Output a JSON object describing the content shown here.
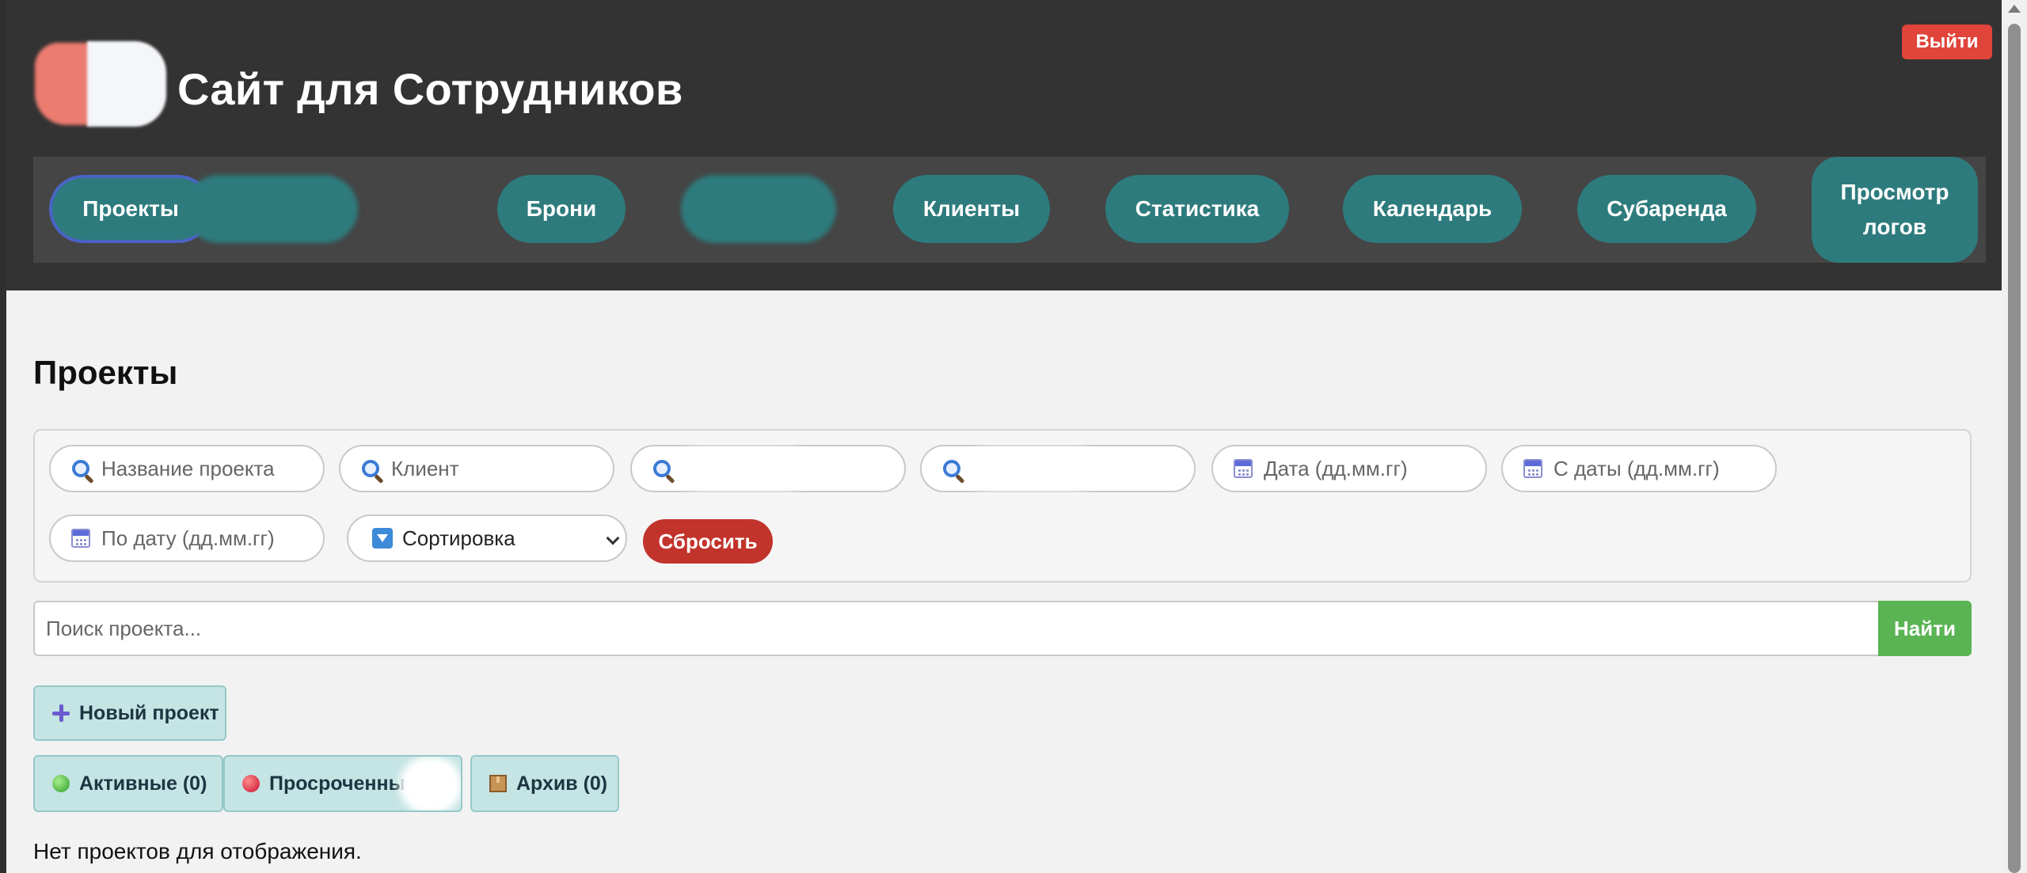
{
  "header": {
    "site_title": "Сайт для Сотрудников",
    "logout_label": "Выйти",
    "logo_colors": [
      "#ec7b70",
      "#f4f6f9"
    ]
  },
  "nav": {
    "items": [
      {
        "label": "Проекты",
        "active": true
      },
      {
        "label": "",
        "redacted": true
      },
      {
        "label": "Брони"
      },
      {
        "label": "",
        "redacted": true
      },
      {
        "label": "Клиенты"
      },
      {
        "label": "Статистика"
      },
      {
        "label": "Календарь"
      },
      {
        "label": "Субаренда"
      },
      {
        "label": "Просмотр логов"
      }
    ],
    "button_color": "#2e7b7d",
    "active_border_color": "#4a64c5"
  },
  "main": {
    "page_title": "Проекты",
    "filters": {
      "project_name_placeholder": "Название проекта",
      "client_placeholder": "Клиент",
      "date_placeholder": "Дата (дд.мм.гг)",
      "from_date_placeholder": "С даты (дд.мм.гг)",
      "to_date_placeholder": "По дату (дд.мм.гг)",
      "sort_label": "Сортировка",
      "reset_label": "Сбросить"
    },
    "search": {
      "placeholder": "Поиск проекта...",
      "button_label": "Найти"
    },
    "new_project_label": "Новый проект",
    "tabs": [
      {
        "label": "Активные (0)",
        "icon": "green-circle-icon"
      },
      {
        "label": "Просроченные",
        "icon": "red-circle-icon"
      },
      {
        "label": "Архив (0)",
        "icon": "package-icon"
      }
    ],
    "empty_message": "Нет проектов для отображения."
  },
  "colors": {
    "logout": "#e0443a",
    "reset": "#c2332b",
    "find": "#5ab454",
    "tab_bg": "#c5e4e4"
  }
}
